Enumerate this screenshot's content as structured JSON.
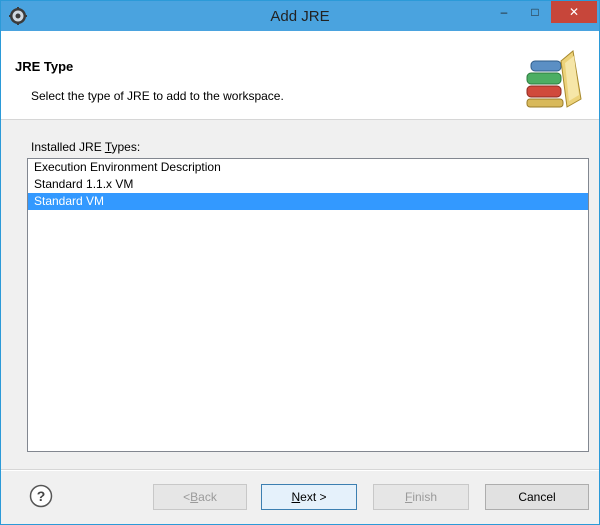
{
  "window": {
    "title": "Add JRE",
    "min_glyph": "–",
    "max_glyph": "□",
    "close_glyph": "✕"
  },
  "banner": {
    "title": "JRE Type",
    "description": "Select the type of JRE to add to the workspace."
  },
  "list": {
    "label_pre": "Installed JRE ",
    "label_mnemonic": "T",
    "label_post": "ypes:",
    "items": [
      {
        "label": "Execution Environment Description",
        "selected": false
      },
      {
        "label": "Standard 1.1.x VM",
        "selected": false
      },
      {
        "label": "Standard VM",
        "selected": true
      }
    ]
  },
  "footer": {
    "help_glyph": "?",
    "back": {
      "pre": "< ",
      "mnemonic": "B",
      "post": "ack",
      "enabled": false
    },
    "next": {
      "pre": "",
      "mnemonic": "N",
      "post": "ext >",
      "enabled": true
    },
    "finish": {
      "pre": "",
      "mnemonic": "F",
      "post": "inish",
      "enabled": false
    },
    "cancel": {
      "label": "Cancel",
      "enabled": true
    }
  },
  "colors": {
    "titlebar": "#4aa3df",
    "close_button": "#c7463a",
    "selection": "#3399ff"
  },
  "icons": {
    "app": "eclipse-gear-icon",
    "banner": "books-library-icon",
    "help": "help-circle-icon"
  }
}
